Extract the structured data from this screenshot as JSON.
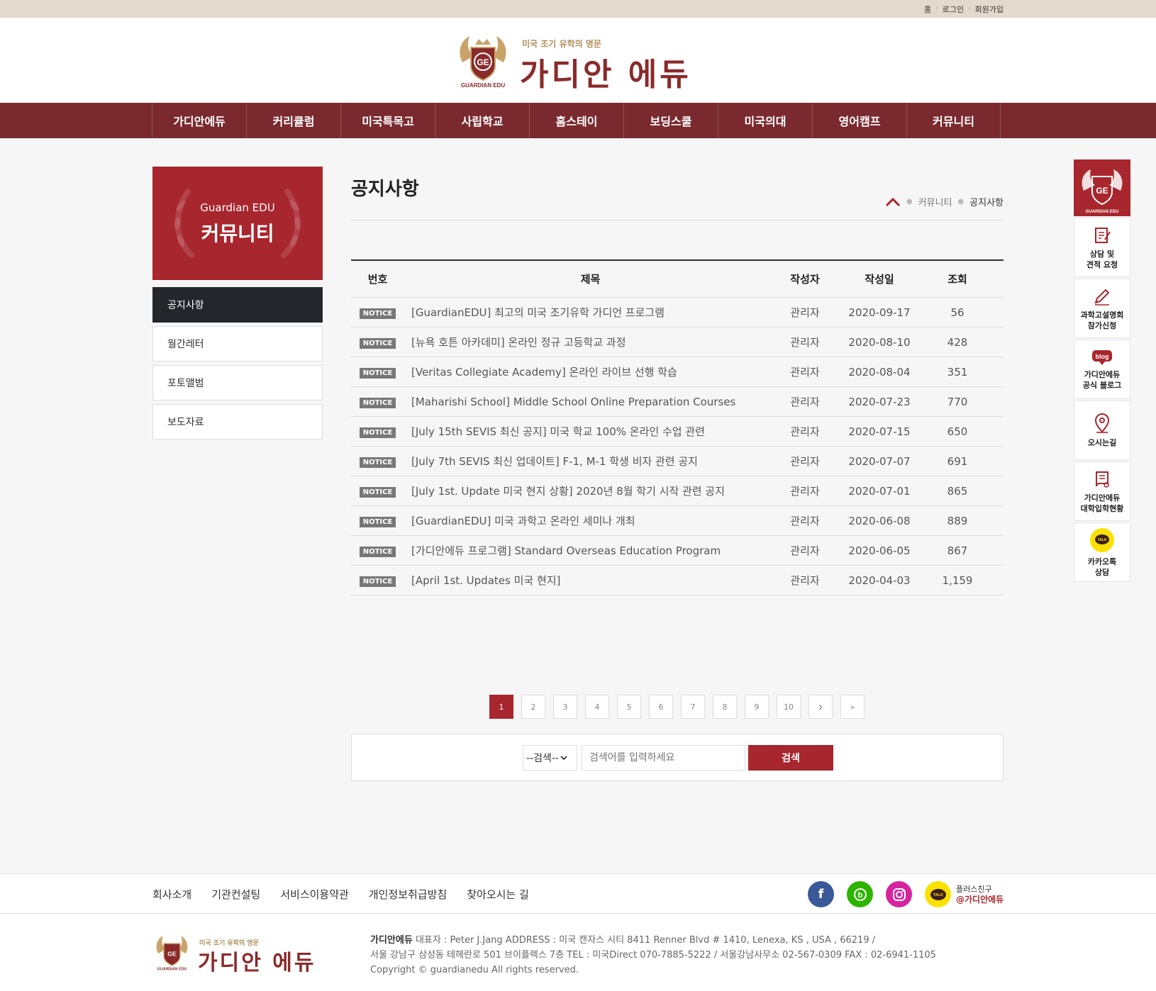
{
  "topbar": {
    "links": [
      "홈",
      "로그인",
      "회원가입"
    ]
  },
  "header": {
    "tagline": "미국 조기 유학의 명문",
    "brand": "가디안 에듀",
    "emblem_text": "GUARDIAN EDU"
  },
  "gnb": [
    "가디안에듀",
    "커리큘럼",
    "미국특목고",
    "사립학교",
    "홈스테이",
    "보딩스쿨",
    "미국의대",
    "영어캠프",
    "커뮤니티"
  ],
  "lnb": {
    "sub": "Guardian EDU",
    "title": "커뮤니티",
    "items": [
      "공지사항",
      "월간레터",
      "포토앨범",
      "보도자료"
    ],
    "active": "공지사항"
  },
  "page": {
    "title": "공지사항",
    "breadcrumb": [
      "커뮤니티",
      "공지사항"
    ]
  },
  "board": {
    "headers": {
      "num": "번호",
      "title": "제목",
      "writer": "작성자",
      "date": "작성일",
      "views": "조회"
    },
    "badge": "NOTICE",
    "rows": [
      {
        "title": "[GuardianEDU] 최고의 미국 조기유학 가디언 프로그램",
        "writer": "관리자",
        "date": "2020-09-17",
        "views": "56"
      },
      {
        "title": "[뉴욕 호튼 아카데미] 온라인 정규 고등학교 과정",
        "writer": "관리자",
        "date": "2020-08-10",
        "views": "428"
      },
      {
        "title": "[Veritas Collegiate Academy] 온라인 라이브 선행 학습",
        "writer": "관리자",
        "date": "2020-08-04",
        "views": "351"
      },
      {
        "title": "[Maharishi School] Middle School Online Preparation Courses",
        "writer": "관리자",
        "date": "2020-07-23",
        "views": "770"
      },
      {
        "title": "[July 15th SEVIS 최신 공지] 미국 학교 100% 온라인 수업 관련",
        "writer": "관리자",
        "date": "2020-07-15",
        "views": "650"
      },
      {
        "title": "[July 7th SEVIS 최신 업데이트] F-1, M-1 학생 비자 관련 공지",
        "writer": "관리자",
        "date": "2020-07-07",
        "views": "691"
      },
      {
        "title": "[July 1st. Update 미국 현지 상황] 2020년 8월 학기 시작 관련 공지",
        "writer": "관리자",
        "date": "2020-07-01",
        "views": "865"
      },
      {
        "title": "[GuardianEDU] 미국 과학고 온라인 세미나 개최",
        "writer": "관리자",
        "date": "2020-06-08",
        "views": "889"
      },
      {
        "title": "[가디안에듀 프로그램] Standard Overseas Education Program",
        "writer": "관리자",
        "date": "2020-06-05",
        "views": "867"
      },
      {
        "title": "[April 1st. Updates 미국 현지]",
        "writer": "관리자",
        "date": "2020-04-03",
        "views": "1,159"
      }
    ]
  },
  "paging": {
    "pages": [
      "1",
      "2",
      "3",
      "4",
      "5",
      "6",
      "7",
      "8",
      "9",
      "10"
    ],
    "current": "1",
    "next": "›",
    "last": "»"
  },
  "search": {
    "select_value": "--검색--",
    "placeholder": "검색어를 입력하세요",
    "button": "검색"
  },
  "quick": {
    "items": [
      {
        "label1": "상담 및",
        "label2": "견적 요청",
        "icon": "consult-icon"
      },
      {
        "label1": "과학고설명회",
        "label2": "참가신청",
        "icon": "pencil-icon"
      },
      {
        "label1": "가디안에듀",
        "label2": "공식 블로그",
        "icon": "blog-icon",
        "badge": "blog"
      },
      {
        "label1": "오시는길",
        "label2": "",
        "icon": "map-pin-icon"
      },
      {
        "label1": "가디안에듀",
        "label2": "대학입학현황",
        "icon": "diploma-icon"
      },
      {
        "label1": "카카오톡",
        "label2": "상담",
        "icon": "kakao-talk-icon",
        "badge": "TALK"
      }
    ]
  },
  "footer_nav": {
    "links": [
      "회사소개",
      "기관컨설팅",
      "서비스이용약관",
      "개인정보취급방침",
      "찾아오시는 길"
    ],
    "plus_label": "플러스친구",
    "plus_id": "@가디안에듀",
    "kakao_badge": "TALK"
  },
  "footer": {
    "company": "가디안에듀",
    "line1": " 대표자 : Peter J.Jang   ADDRESS : 미국 캔자스 시티 8411 Renner Blvd # 1410, Lenexa, KS , USA , 66219 /",
    "line2": "서울 강남구 삼성동 테헤란로 501 브이플렉스 7층   TEL : 미국Direct 070-7885-5222 / 서울강남사무소 02-567-0309   FAX : 02-6941-1105",
    "line3": "Copyright © guardianedu  All rights reserved."
  },
  "colors": {
    "brand_red": "#a8262d",
    "gnb_bg": "#7a2a2e",
    "topbar_bg": "#e3d9cd",
    "gold": "#b08f5a"
  }
}
